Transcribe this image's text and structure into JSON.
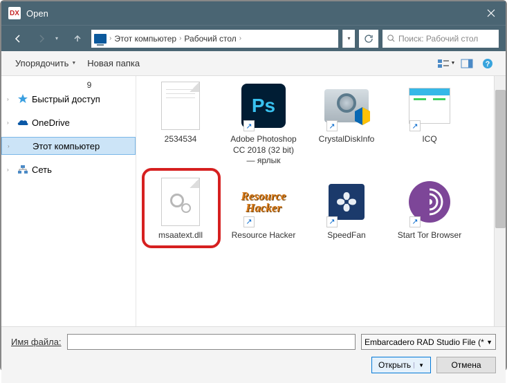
{
  "window": {
    "title": "Open"
  },
  "breadcrumb": {
    "root": "Этот компьютер",
    "folder": "Рабочий стол"
  },
  "search": {
    "placeholder": "Поиск: Рабочий стол"
  },
  "toolbar": {
    "organize": "Упорядочить",
    "new_folder": "Новая папка"
  },
  "tree": {
    "truncated_above": "9",
    "items": [
      {
        "label": "Быстрый доступ"
      },
      {
        "label": "OneDrive"
      },
      {
        "label": "Этот компьютер"
      },
      {
        "label": "Сеть"
      }
    ]
  },
  "files": {
    "row1": [
      {
        "label": "2534534",
        "type": "doc"
      },
      {
        "label": "Adobe Photoshop CC 2018 (32 bit) — ярлык",
        "type": "ps"
      },
      {
        "label": "CrystalDiskInfo",
        "type": "cdi"
      },
      {
        "label": "ICQ",
        "type": "icq"
      }
    ],
    "row2": [
      {
        "label": "msaatext.dll",
        "type": "dll"
      },
      {
        "label": "Resource Hacker",
        "type": "rh"
      },
      {
        "label": "SpeedFan",
        "type": "sf"
      },
      {
        "label": "Start Tor Browser",
        "type": "tor"
      }
    ]
  },
  "footer": {
    "filename_label": "Имя файла:",
    "filename_value": "",
    "filter": "Embarcadero RAD Studio File (*",
    "open": "Открыть",
    "cancel": "Отмена"
  }
}
